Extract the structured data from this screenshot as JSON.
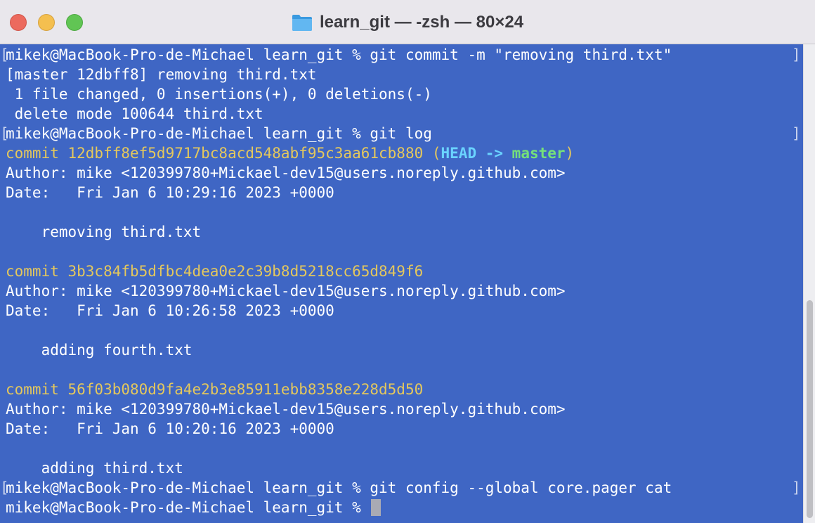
{
  "window": {
    "title": "learn_git — -zsh — 80×24"
  },
  "terminal": {
    "lines": [
      {
        "segments": [
          {
            "text": "mikek@MacBook-Pro-de-Michael learn_git % git commit -m \"removing third.txt\"",
            "color": "white"
          }
        ],
        "mark": true
      },
      {
        "segments": [
          {
            "text": "[master 12dbff8] removing third.txt",
            "color": "white"
          }
        ]
      },
      {
        "segments": [
          {
            "text": " 1 file changed, 0 insertions(+), 0 deletions(-)",
            "color": "white"
          }
        ]
      },
      {
        "segments": [
          {
            "text": " delete mode 100644 third.txt",
            "color": "white"
          }
        ]
      },
      {
        "segments": [
          {
            "text": "mikek@MacBook-Pro-de-Michael learn_git % git log",
            "color": "white"
          }
        ],
        "mark": true
      },
      {
        "segments": [
          {
            "text": "commit 12dbff8ef5d9717bc8acd548abf95c3aa61cb880 (",
            "color": "yellow"
          },
          {
            "text": "HEAD -> ",
            "color": "cyan"
          },
          {
            "text": "master",
            "color": "green"
          },
          {
            "text": ")",
            "color": "yellow"
          }
        ]
      },
      {
        "segments": [
          {
            "text": "Author: mike <120399780+Mickael-dev15@users.noreply.github.com>",
            "color": "white"
          }
        ]
      },
      {
        "segments": [
          {
            "text": "Date:   Fri Jan 6 10:29:16 2023 +0000",
            "color": "white"
          }
        ]
      },
      {
        "segments": [
          {
            "text": "",
            "color": "white"
          }
        ]
      },
      {
        "segments": [
          {
            "text": "    removing third.txt",
            "color": "white"
          }
        ]
      },
      {
        "segments": [
          {
            "text": "",
            "color": "white"
          }
        ]
      },
      {
        "segments": [
          {
            "text": "commit 3b3c84fb5dfbc4dea0e2c39b8d5218cc65d849f6",
            "color": "yellow"
          }
        ]
      },
      {
        "segments": [
          {
            "text": "Author: mike <120399780+Mickael-dev15@users.noreply.github.com>",
            "color": "white"
          }
        ]
      },
      {
        "segments": [
          {
            "text": "Date:   Fri Jan 6 10:26:58 2023 +0000",
            "color": "white"
          }
        ]
      },
      {
        "segments": [
          {
            "text": "",
            "color": "white"
          }
        ]
      },
      {
        "segments": [
          {
            "text": "    adding fourth.txt",
            "color": "white"
          }
        ]
      },
      {
        "segments": [
          {
            "text": "",
            "color": "white"
          }
        ]
      },
      {
        "segments": [
          {
            "text": "commit 56f03b080d9fa4e2b3e85911ebb8358e228d5d50",
            "color": "yellow"
          }
        ]
      },
      {
        "segments": [
          {
            "text": "Author: mike <120399780+Mickael-dev15@users.noreply.github.com>",
            "color": "white"
          }
        ]
      },
      {
        "segments": [
          {
            "text": "Date:   Fri Jan 6 10:20:16 2023 +0000",
            "color": "white"
          }
        ]
      },
      {
        "segments": [
          {
            "text": "",
            "color": "white"
          }
        ]
      },
      {
        "segments": [
          {
            "text": "    adding third.txt",
            "color": "white"
          }
        ]
      },
      {
        "segments": [
          {
            "text": "mikek@MacBook-Pro-de-Michael learn_git % git config --global core.pager cat",
            "color": "white"
          }
        ],
        "mark": true
      },
      {
        "segments": [
          {
            "text": "mikek@MacBook-Pro-de-Michael learn_git % ",
            "color": "white"
          }
        ],
        "cursor": true
      }
    ]
  },
  "icons": {
    "title_icon": "folder-icon",
    "close": "close-icon",
    "minimize": "minimize-icon",
    "maximize": "maximize-icon"
  },
  "colors": {
    "background": "#3f66c4",
    "text": "#ffffff",
    "commit_hash": "#e5c85c",
    "head_ref": "#6ad3ff",
    "branch": "#75e07a"
  }
}
